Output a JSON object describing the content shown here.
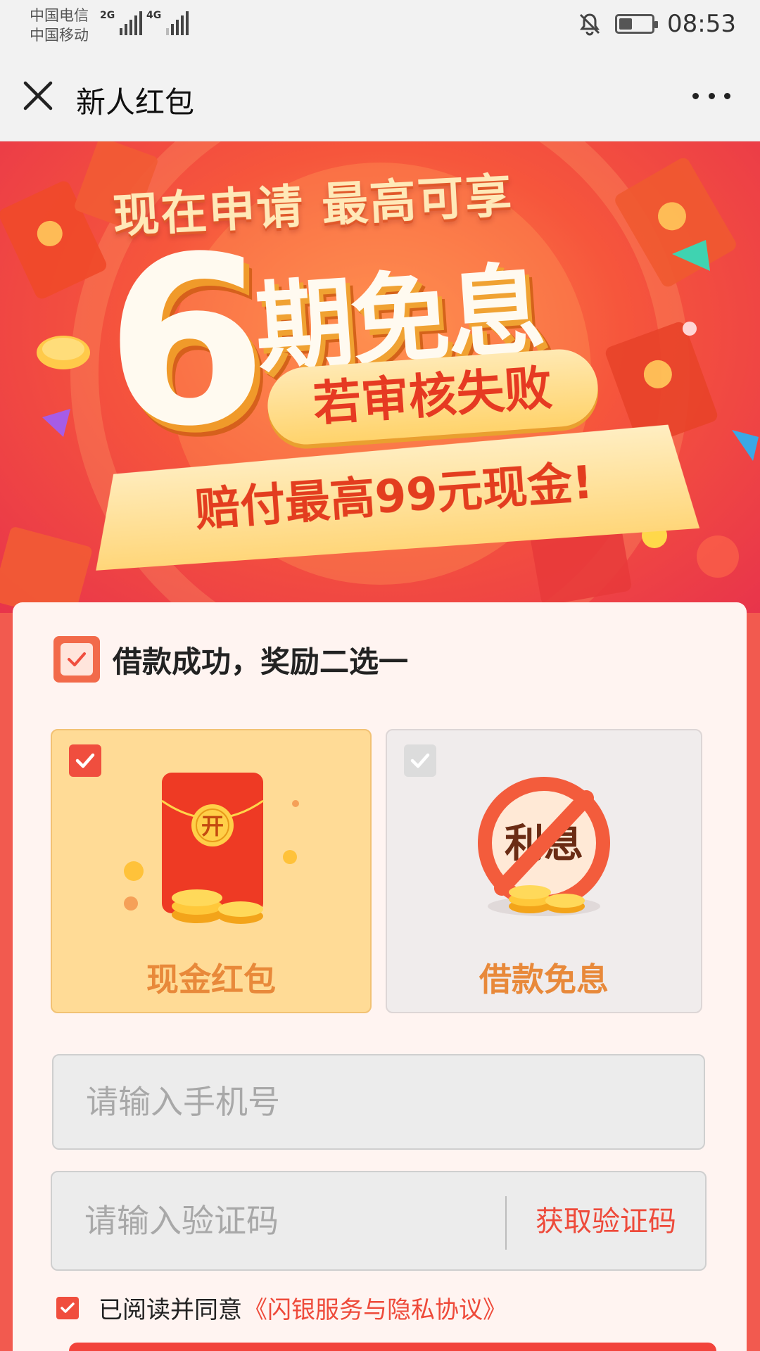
{
  "status_bar": {
    "carrier1": "中国电信",
    "carrier2": "中国移动",
    "network1": "2G",
    "network2": "4G",
    "time": "08:53",
    "battery_level": 0.4,
    "icons": [
      "signal-icon",
      "mute-bell-icon",
      "battery-icon"
    ]
  },
  "nav": {
    "title": "新人红包",
    "close_icon": "close-icon",
    "more_icon": "more-icon"
  },
  "banner": {
    "line1": "现在申请  最高可享",
    "big_number": "6",
    "line2": "期免息",
    "pill_text": "若审核失败",
    "ribbon_text": "赔付最高99元现金!"
  },
  "reward": {
    "title": "借款成功，奖励二选一",
    "options": [
      {
        "label": "现金红包",
        "selected": true,
        "badge": "开"
      },
      {
        "label": "借款免息",
        "selected": false,
        "badge": "利息"
      }
    ]
  },
  "form": {
    "phone_placeholder": "请输入手机号",
    "code_placeholder": "请输入验证码",
    "get_code_label": "获取验证码",
    "agree_text": "已阅读并同意",
    "agree_link": "《闪银服务与隐私协议》"
  },
  "colors": {
    "accent": "#f04e3e",
    "gold": "#ffdb96",
    "orange_text": "#e8893a"
  }
}
